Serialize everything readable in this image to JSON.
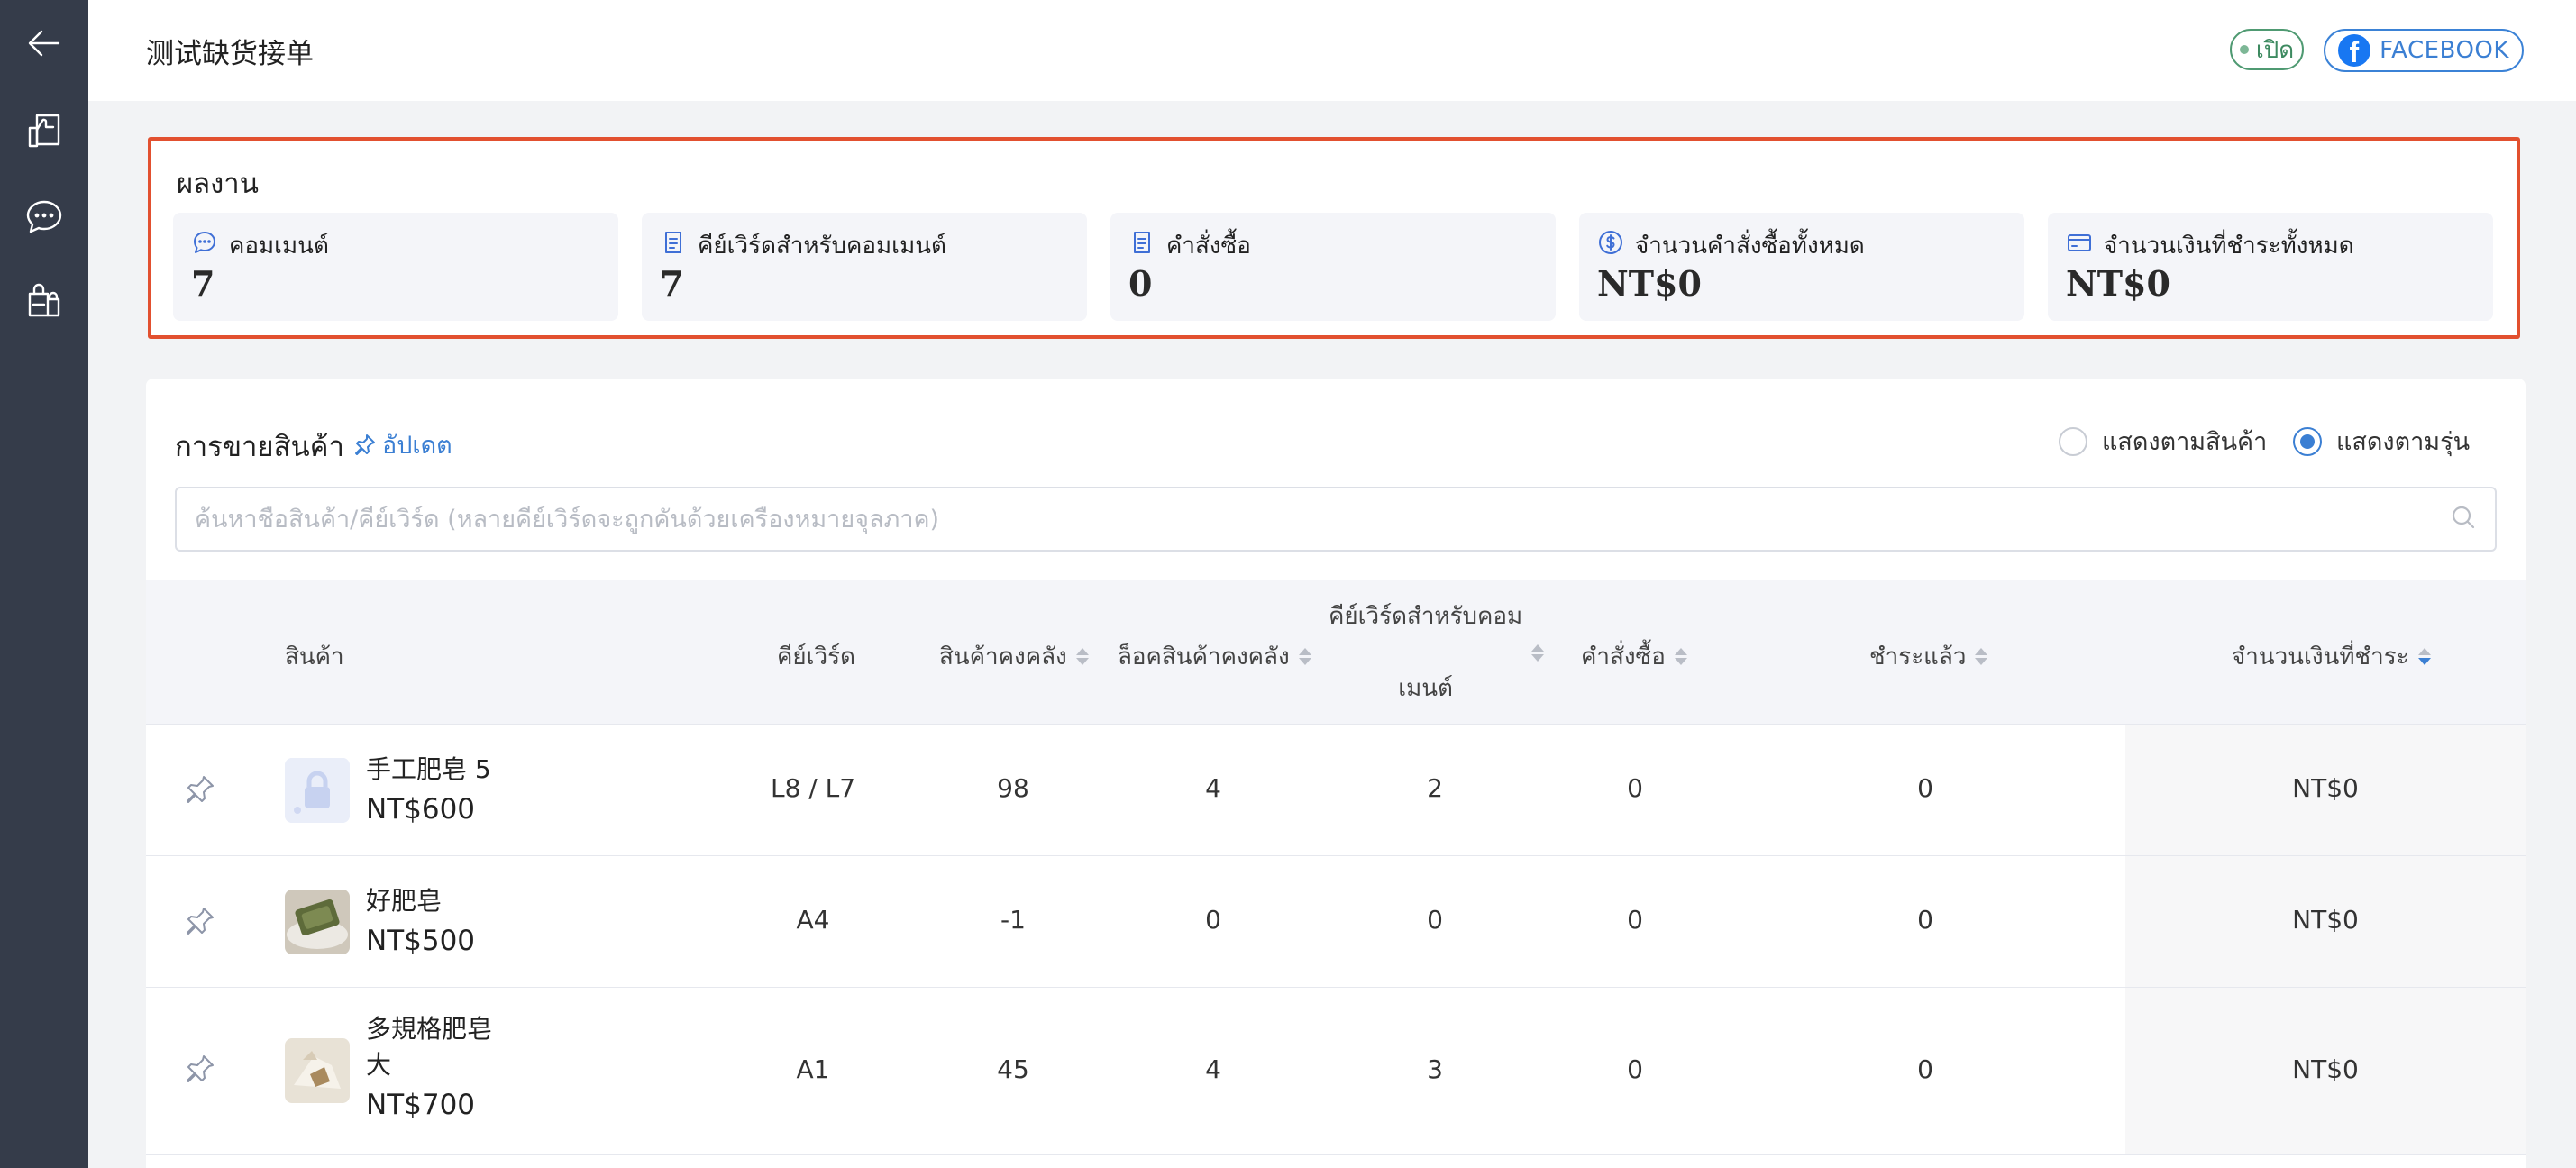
{
  "sidebar": {
    "items": [
      {
        "icon": "back-arrow-icon"
      },
      {
        "icon": "thumbs-up-page-icon"
      },
      {
        "icon": "chat-bubble-icon"
      },
      {
        "icon": "shopping-bags-icon"
      }
    ]
  },
  "header": {
    "title": "测试缺货接单",
    "status_label": "เปิด",
    "facebook_label": "FACEBOOK"
  },
  "performance": {
    "title": "ผลงาน",
    "stats": [
      {
        "label": "คอมเมนต์",
        "value": "7",
        "icon": "comment-icon"
      },
      {
        "label": "คีย์เวิร์ดสำหรับคอมเมนต์",
        "value": "7",
        "icon": "note-icon"
      },
      {
        "label": "คำสั่งซื้อ",
        "value": "0",
        "icon": "note-icon"
      },
      {
        "label": "จำนวนคำสั่งซื้อทั้งหมด",
        "value": "NT$0",
        "icon": "dollar-circle-icon"
      },
      {
        "label": "จำนวนเงินที่ชำระทั้งหมด",
        "value": "NT$0",
        "icon": "credit-card-icon"
      }
    ]
  },
  "sales": {
    "title": "การขายสินค้า",
    "update_label": "อัปเดต",
    "view_options": [
      {
        "label": "แสดงตามสินค้า",
        "checked": false
      },
      {
        "label": "แสดงตามรุ่น",
        "checked": true
      }
    ],
    "search_placeholder": "ค้นหาชื่อสินค้า/คีย์เวิร์ด (หลายคีย์เวิร์ดจะถูกคั่นด้วยเครื่องหมายจุลภาค)",
    "columns": {
      "product": "สินค้า",
      "keyword": "คีย์เวิร์ด",
      "stock": "สินค้าคงคลัง",
      "locked_stock": "ล็อคสินค้าคงคลัง",
      "comment_keyword_line1": "คีย์เวิร์ดสำหรับคอม",
      "comment_keyword_line2": "เมนต์",
      "orders": "คำสั่งซื้อ",
      "paid": "ชำระแล้ว",
      "paid_amount": "จำนวนเงินที่ชำระ"
    },
    "rows": [
      {
        "name": "手工肥皂 5",
        "price": "NT$600",
        "keyword": "L8 / L7",
        "stock": "98",
        "locked_stock": "4",
        "comment_keyword": "2",
        "orders": "0",
        "paid": "0",
        "paid_amount": "NT$0"
      },
      {
        "name": "好肥皂",
        "price": "NT$500",
        "keyword": "A4",
        "stock": "-1",
        "locked_stock": "0",
        "comment_keyword": "0",
        "orders": "0",
        "paid": "0",
        "paid_amount": "NT$0"
      },
      {
        "name_line1": "多規格肥皂",
        "name_line2": "大",
        "price": "NT$700",
        "keyword": "A1",
        "stock": "45",
        "locked_stock": "4",
        "comment_keyword": "3",
        "orders": "0",
        "paid": "0",
        "paid_amount": "NT$0"
      }
    ]
  },
  "colors": {
    "sidebar_bg": "#353c4a",
    "accent": "#3b7fd3",
    "highlight_border": "#e2502f",
    "status_green": "#3d8a60"
  }
}
